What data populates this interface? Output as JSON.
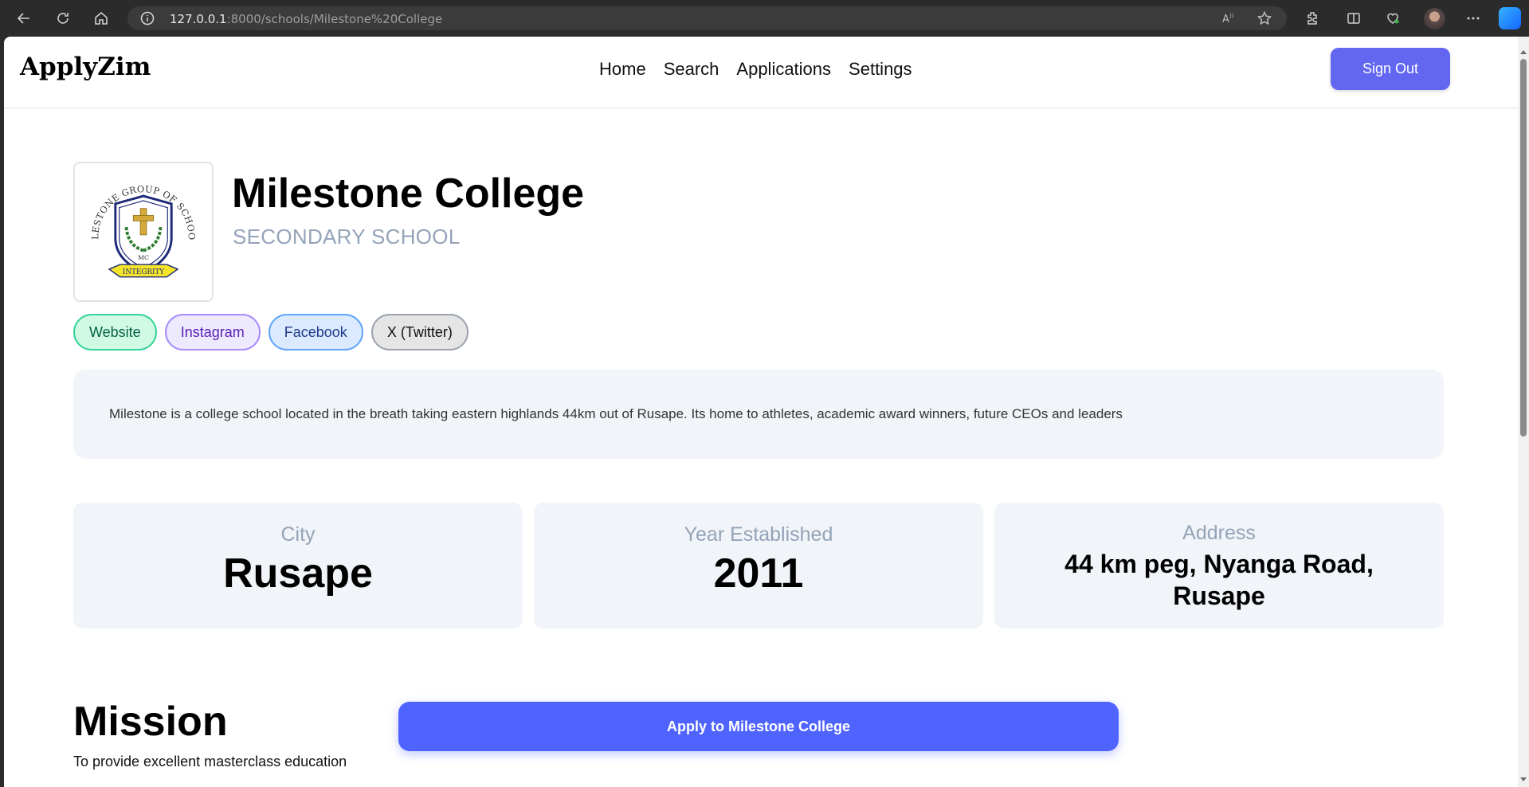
{
  "browser": {
    "url_host": "127.0.0.1",
    "url_path": ":8000/schools/Milestone%20College"
  },
  "navbar": {
    "brand": "ApplyZim",
    "links": [
      "Home",
      "Search",
      "Applications",
      "Settings"
    ],
    "signout_label": "Sign Out"
  },
  "school": {
    "name": "Milestone College",
    "type": "SECONDARY SCHOOL",
    "logo_text": {
      "ring": "MILESTONE GROUP OF SCHOOLS",
      "initials": "MC",
      "motto": "INTEGRITY"
    },
    "socials": [
      "Website",
      "Instagram",
      "Facebook",
      "X (Twitter)"
    ],
    "description": "Milestone is a college school located in the breath taking eastern highlands 44km out of Rusape. Its home to athletes, academic award winners, future CEOs and leaders",
    "info": {
      "city_label": "City",
      "city_value": "Rusape",
      "year_label": "Year Established",
      "year_value": "2011",
      "address_label": "Address",
      "address_line1": "44 km peg, Nyanga Road,",
      "address_line2": "Rusape"
    },
    "mission_title": "Mission",
    "mission_text": "To provide excellent masterclass education",
    "apply_label": "Apply to Milestone College"
  },
  "colors": {
    "accent": "#6366f1",
    "apply": "#4f63ff"
  }
}
